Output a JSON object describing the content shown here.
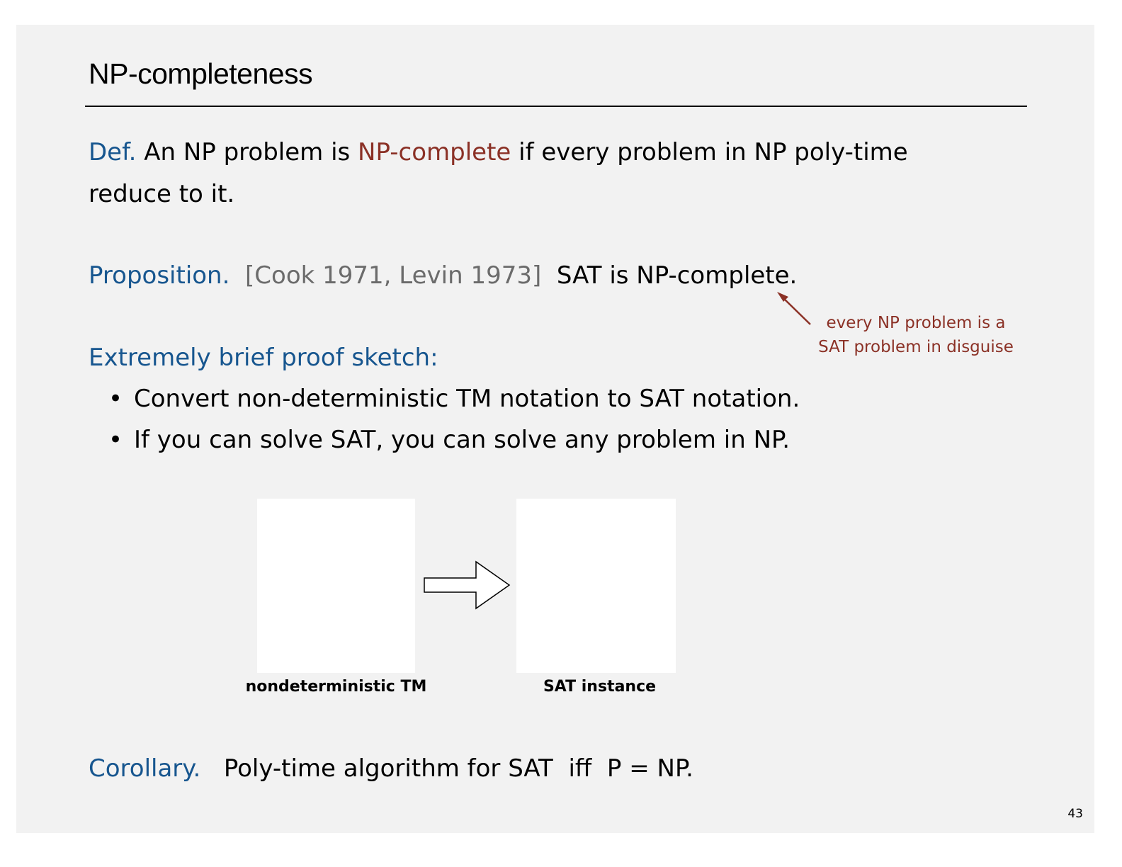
{
  "slide": {
    "title": "NP-completeness",
    "page_number": "43"
  },
  "definition": {
    "label": "Def.",
    "text_before": "An NP problem is",
    "term": "NP-complete",
    "text_after": "if every problem in NP poly-time",
    "continuation": "reduce to it."
  },
  "proposition": {
    "label": "Proposition.",
    "citation": "[Cook 1971, Levin 1973]",
    "statement": "SAT is NP-complete."
  },
  "annotation": {
    "line1": "every NP problem is a",
    "line2": "SAT problem in disguise"
  },
  "proof_sketch": {
    "label": "Extremely brief proof sketch:",
    "bullets": [
      "Convert non-deterministic TM notation to SAT notation.",
      "If you can solve SAT, you can solve any problem in NP."
    ]
  },
  "diagram": {
    "left_caption": "nondeterministic TM",
    "right_caption": "SAT instance"
  },
  "corollary": {
    "label": "Corollary.",
    "statement": "Poly-time algorithm for SAT  iff  P = NP."
  },
  "colors": {
    "label_blue": "#17568f",
    "accent_red": "#8b3126",
    "citation_gray": "#6b6b6b",
    "background": "#f2f2f2"
  }
}
